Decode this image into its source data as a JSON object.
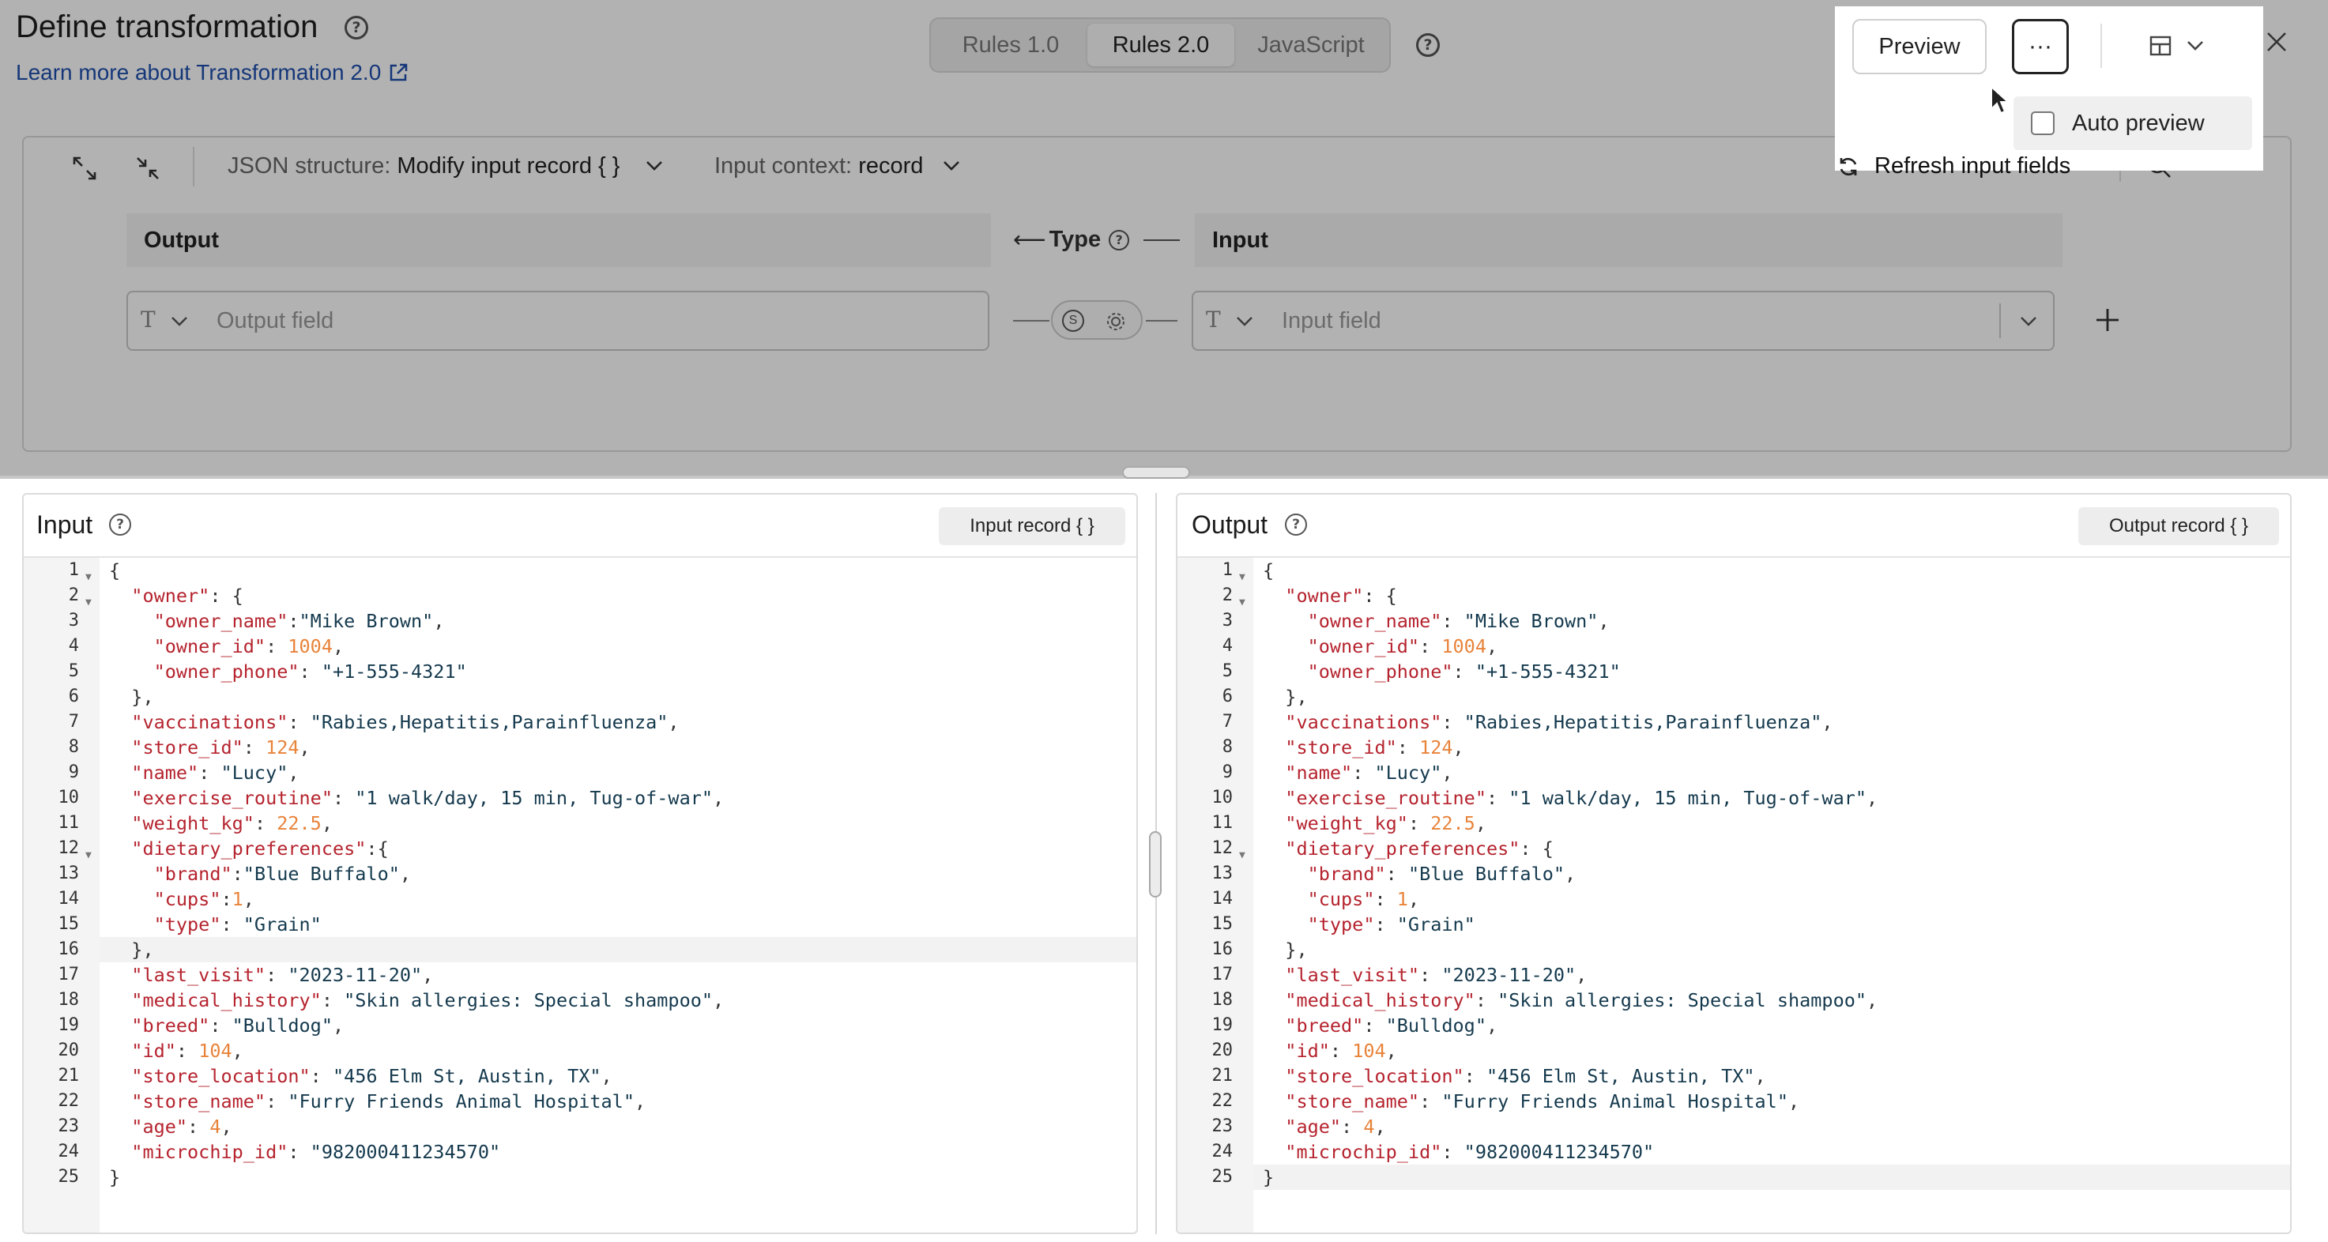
{
  "header": {
    "title": "Define transformation",
    "learn_more": "Learn more about Transformation 2.0",
    "tabs": [
      "Rules 1.0",
      "Rules 2.0",
      "JavaScript"
    ],
    "active_tab": "Rules 2.0"
  },
  "toolbar": {
    "json_structure_label": "JSON structure:",
    "json_structure_value": "Modify input record { }",
    "input_context_label": "Input context:",
    "input_context_value": "record",
    "refresh_label": "Refresh input fields"
  },
  "mapping": {
    "output_header": "Output",
    "type_header": "Type",
    "input_header": "Input",
    "output_placeholder": "Output field",
    "input_placeholder": "Input field",
    "type_glyph": "T"
  },
  "popover": {
    "preview_label": "Preview",
    "more_label": "···",
    "auto_preview_label": "Auto preview",
    "auto_preview_checked": false
  },
  "input_pane": {
    "title": "Input",
    "button": "Input record { }"
  },
  "output_pane": {
    "title": "Output",
    "button": "Output record { }"
  },
  "code_input": [
    [
      [
        "p",
        "{"
      ]
    ],
    [
      [
        "p",
        "  "
      ],
      [
        "k",
        "\"owner\""
      ],
      [
        "p",
        ": {"
      ]
    ],
    [
      [
        "p",
        "    "
      ],
      [
        "k",
        "\"owner_name\""
      ],
      [
        "p",
        ":"
      ],
      [
        "s",
        "\"Mike Brown\""
      ],
      [
        "p",
        ","
      ]
    ],
    [
      [
        "p",
        "    "
      ],
      [
        "k",
        "\"owner_id\""
      ],
      [
        "p",
        ": "
      ],
      [
        "n",
        "1004"
      ],
      [
        "p",
        ","
      ]
    ],
    [
      [
        "p",
        "    "
      ],
      [
        "k",
        "\"owner_phone\""
      ],
      [
        "p",
        ": "
      ],
      [
        "s",
        "\"+1-555-4321\""
      ]
    ],
    [
      [
        "p",
        "  },"
      ]
    ],
    [
      [
        "p",
        "  "
      ],
      [
        "k",
        "\"vaccinations\""
      ],
      [
        "p",
        ": "
      ],
      [
        "s",
        "\"Rabies,Hepatitis,Parainfluenza\""
      ],
      [
        "p",
        ","
      ]
    ],
    [
      [
        "p",
        "  "
      ],
      [
        "k",
        "\"store_id\""
      ],
      [
        "p",
        ": "
      ],
      [
        "n",
        "124"
      ],
      [
        "p",
        ","
      ]
    ],
    [
      [
        "p",
        "  "
      ],
      [
        "k",
        "\"name\""
      ],
      [
        "p",
        ": "
      ],
      [
        "s",
        "\"Lucy\""
      ],
      [
        "p",
        ","
      ]
    ],
    [
      [
        "p",
        "  "
      ],
      [
        "k",
        "\"exercise_routine\""
      ],
      [
        "p",
        ": "
      ],
      [
        "s",
        "\"1 walk/day, 15 min, Tug-of-war\""
      ],
      [
        "p",
        ","
      ]
    ],
    [
      [
        "p",
        "  "
      ],
      [
        "k",
        "\"weight_kg\""
      ],
      [
        "p",
        ": "
      ],
      [
        "n",
        "22.5"
      ],
      [
        "p",
        ","
      ]
    ],
    [
      [
        "p",
        "  "
      ],
      [
        "k",
        "\"dietary_preferences\""
      ],
      [
        "p",
        ":{"
      ]
    ],
    [
      [
        "p",
        "    "
      ],
      [
        "k",
        "\"brand\""
      ],
      [
        "p",
        ":"
      ],
      [
        "s",
        "\"Blue Buffalo\""
      ],
      [
        "p",
        ","
      ]
    ],
    [
      [
        "p",
        "    "
      ],
      [
        "k",
        "\"cups\""
      ],
      [
        "p",
        ":"
      ],
      [
        "n",
        "1"
      ],
      [
        "p",
        ","
      ]
    ],
    [
      [
        "p",
        "    "
      ],
      [
        "k",
        "\"type\""
      ],
      [
        "p",
        ": "
      ],
      [
        "s",
        "\"Grain\""
      ]
    ],
    [
      [
        "p",
        "  },"
      ]
    ],
    [
      [
        "p",
        "  "
      ],
      [
        "k",
        "\"last_visit\""
      ],
      [
        "p",
        ": "
      ],
      [
        "s",
        "\"2023-11-20\""
      ],
      [
        "p",
        ","
      ]
    ],
    [
      [
        "p",
        "  "
      ],
      [
        "k",
        "\"medical_history\""
      ],
      [
        "p",
        ": "
      ],
      [
        "s",
        "\"Skin allergies: Special shampoo\""
      ],
      [
        "p",
        ","
      ]
    ],
    [
      [
        "p",
        "  "
      ],
      [
        "k",
        "\"breed\""
      ],
      [
        "p",
        ": "
      ],
      [
        "s",
        "\"Bulldog\""
      ],
      [
        "p",
        ","
      ]
    ],
    [
      [
        "p",
        "  "
      ],
      [
        "k",
        "\"id\""
      ],
      [
        "p",
        ": "
      ],
      [
        "n",
        "104"
      ],
      [
        "p",
        ","
      ]
    ],
    [
      [
        "p",
        "  "
      ],
      [
        "k",
        "\"store_location\""
      ],
      [
        "p",
        ": "
      ],
      [
        "s",
        "\"456 Elm St, Austin, TX\""
      ],
      [
        "p",
        ","
      ]
    ],
    [
      [
        "p",
        "  "
      ],
      [
        "k",
        "\"store_name\""
      ],
      [
        "p",
        ": "
      ],
      [
        "s",
        "\"Furry Friends Animal Hospital\""
      ],
      [
        "p",
        ","
      ]
    ],
    [
      [
        "p",
        "  "
      ],
      [
        "k",
        "\"age\""
      ],
      [
        "p",
        ": "
      ],
      [
        "n",
        "4"
      ],
      [
        "p",
        ","
      ]
    ],
    [
      [
        "p",
        "  "
      ],
      [
        "k",
        "\"microchip_id\""
      ],
      [
        "p",
        ": "
      ],
      [
        "s",
        "\"982000411234570\""
      ]
    ],
    [
      [
        "p",
        "}"
      ]
    ]
  ],
  "code_output": [
    [
      [
        "p",
        "{"
      ]
    ],
    [
      [
        "p",
        "  "
      ],
      [
        "k",
        "\"owner\""
      ],
      [
        "p",
        ": {"
      ]
    ],
    [
      [
        "p",
        "    "
      ],
      [
        "k",
        "\"owner_name\""
      ],
      [
        "p",
        ": "
      ],
      [
        "s",
        "\"Mike Brown\""
      ],
      [
        "p",
        ","
      ]
    ],
    [
      [
        "p",
        "    "
      ],
      [
        "k",
        "\"owner_id\""
      ],
      [
        "p",
        ": "
      ],
      [
        "n",
        "1004"
      ],
      [
        "p",
        ","
      ]
    ],
    [
      [
        "p",
        "    "
      ],
      [
        "k",
        "\"owner_phone\""
      ],
      [
        "p",
        ": "
      ],
      [
        "s",
        "\"+1-555-4321\""
      ]
    ],
    [
      [
        "p",
        "  },"
      ]
    ],
    [
      [
        "p",
        "  "
      ],
      [
        "k",
        "\"vaccinations\""
      ],
      [
        "p",
        ": "
      ],
      [
        "s",
        "\"Rabies,Hepatitis,Parainfluenza\""
      ],
      [
        "p",
        ","
      ]
    ],
    [
      [
        "p",
        "  "
      ],
      [
        "k",
        "\"store_id\""
      ],
      [
        "p",
        ": "
      ],
      [
        "n",
        "124"
      ],
      [
        "p",
        ","
      ]
    ],
    [
      [
        "p",
        "  "
      ],
      [
        "k",
        "\"name\""
      ],
      [
        "p",
        ": "
      ],
      [
        "s",
        "\"Lucy\""
      ],
      [
        "p",
        ","
      ]
    ],
    [
      [
        "p",
        "  "
      ],
      [
        "k",
        "\"exercise_routine\""
      ],
      [
        "p",
        ": "
      ],
      [
        "s",
        "\"1 walk/day, 15 min, Tug-of-war\""
      ],
      [
        "p",
        ","
      ]
    ],
    [
      [
        "p",
        "  "
      ],
      [
        "k",
        "\"weight_kg\""
      ],
      [
        "p",
        ": "
      ],
      [
        "n",
        "22.5"
      ],
      [
        "p",
        ","
      ]
    ],
    [
      [
        "p",
        "  "
      ],
      [
        "k",
        "\"dietary_preferences\""
      ],
      [
        "p",
        ": {"
      ]
    ],
    [
      [
        "p",
        "    "
      ],
      [
        "k",
        "\"brand\""
      ],
      [
        "p",
        ": "
      ],
      [
        "s",
        "\"Blue Buffalo\""
      ],
      [
        "p",
        ","
      ]
    ],
    [
      [
        "p",
        "    "
      ],
      [
        "k",
        "\"cups\""
      ],
      [
        "p",
        ": "
      ],
      [
        "n",
        "1"
      ],
      [
        "p",
        ","
      ]
    ],
    [
      [
        "p",
        "    "
      ],
      [
        "k",
        "\"type\""
      ],
      [
        "p",
        ": "
      ],
      [
        "s",
        "\"Grain\""
      ]
    ],
    [
      [
        "p",
        "  },"
      ]
    ],
    [
      [
        "p",
        "  "
      ],
      [
        "k",
        "\"last_visit\""
      ],
      [
        "p",
        ": "
      ],
      [
        "s",
        "\"2023-11-20\""
      ],
      [
        "p",
        ","
      ]
    ],
    [
      [
        "p",
        "  "
      ],
      [
        "k",
        "\"medical_history\""
      ],
      [
        "p",
        ": "
      ],
      [
        "s",
        "\"Skin allergies: Special shampoo\""
      ],
      [
        "p",
        ","
      ]
    ],
    [
      [
        "p",
        "  "
      ],
      [
        "k",
        "\"breed\""
      ],
      [
        "p",
        ": "
      ],
      [
        "s",
        "\"Bulldog\""
      ],
      [
        "p",
        ","
      ]
    ],
    [
      [
        "p",
        "  "
      ],
      [
        "k",
        "\"id\""
      ],
      [
        "p",
        ": "
      ],
      [
        "n",
        "104"
      ],
      [
        "p",
        ","
      ]
    ],
    [
      [
        "p",
        "  "
      ],
      [
        "k",
        "\"store_location\""
      ],
      [
        "p",
        ": "
      ],
      [
        "s",
        "\"456 Elm St, Austin, TX\""
      ],
      [
        "p",
        ","
      ]
    ],
    [
      [
        "p",
        "  "
      ],
      [
        "k",
        "\"store_name\""
      ],
      [
        "p",
        ": "
      ],
      [
        "s",
        "\"Furry Friends Animal Hospital\""
      ],
      [
        "p",
        ","
      ]
    ],
    [
      [
        "p",
        "  "
      ],
      [
        "k",
        "\"age\""
      ],
      [
        "p",
        ": "
      ],
      [
        "n",
        "4"
      ],
      [
        "p",
        ","
      ]
    ],
    [
      [
        "p",
        "  "
      ],
      [
        "k",
        "\"microchip_id\""
      ],
      [
        "p",
        ": "
      ],
      [
        "s",
        "\"982000411234570\""
      ]
    ],
    [
      [
        "p",
        "}"
      ]
    ]
  ],
  "colors": {
    "key": "#b5232e",
    "string": "#14394d",
    "number": "#e8833a",
    "link": "#1f4fae"
  }
}
